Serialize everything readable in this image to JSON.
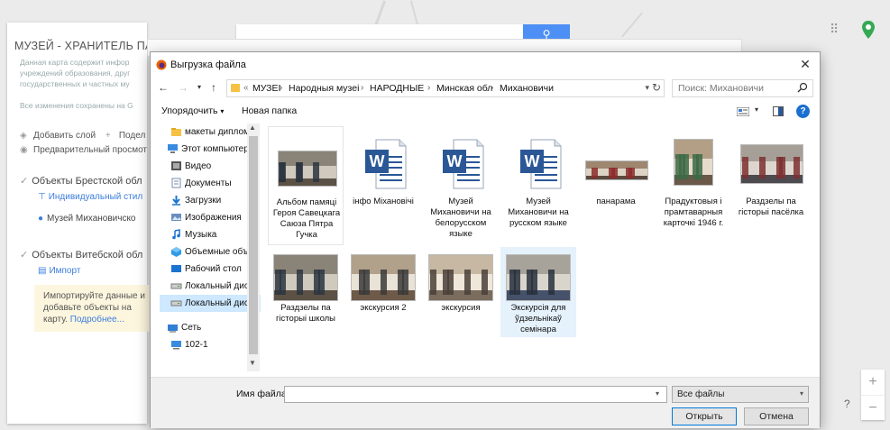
{
  "background": {
    "title": "МУЗЕЙ - ХРАНИТЕЛЬ ПА",
    "desc_lines": [
      "Данная карта содержит инфор",
      "учреждений образования, друг",
      "государственных и частных му"
    ],
    "saved_text": "Все изменения сохранены на G",
    "add_layer": "Добавить слой",
    "share": "Подел",
    "preview": "Предварительный просмот",
    "layer1": "Объекты Брестской обл",
    "layer1_style": "Индивидуальный стил",
    "layer1_item": "Музей Михановичско",
    "layer2": "Объекты Витебской обл",
    "import": "Импорт",
    "hint_text": "Импортируйте данные и добавьте объекты на карту.",
    "hint_more": "Подробнее...",
    "help": "?",
    "zoom_in": "+",
    "zoom_out": "−"
  },
  "dialog": {
    "title": "Выгрузка файла",
    "address": {
      "crumbs": [
        "МУЗЕІ",
        "Народныя музеі",
        "НАРОДНЫЕ",
        "Минская обл",
        "Михановичи"
      ]
    },
    "search_placeholder": "Поиск: Михановичи",
    "toolbar": {
      "organize": "Упорядочить",
      "new_folder": "Новая папка"
    },
    "tree": [
      {
        "label": "макеты дипломо",
        "icon": "folder-icon"
      },
      {
        "label": "Этот компьютер",
        "icon": "computer-icon"
      },
      {
        "label": "Видео",
        "icon": "video-icon"
      },
      {
        "label": "Документы",
        "icon": "documents-icon"
      },
      {
        "label": "Загрузки",
        "icon": "downloads-icon"
      },
      {
        "label": "Изображения",
        "icon": "pictures-icon"
      },
      {
        "label": "Музыка",
        "icon": "music-icon"
      },
      {
        "label": "Объемные объе",
        "icon": "3d-objects-icon"
      },
      {
        "label": "Рабочий стол",
        "icon": "desktop-icon"
      },
      {
        "label": "Локальный диск",
        "icon": "drive-icon"
      },
      {
        "label": "Локальный диск",
        "icon": "drive-icon"
      },
      {
        "label": "Сеть",
        "icon": "network-icon"
      },
      {
        "label": "102-1",
        "icon": "network-computer-icon"
      }
    ],
    "files": [
      {
        "name": "Альбом памяці Героя Савецкага Саюза Пятра Гучка",
        "kind": "photo"
      },
      {
        "name": "інфо Міхановічі",
        "kind": "word"
      },
      {
        "name": "Музей Михановичи на белорусском языке",
        "kind": "word"
      },
      {
        "name": "Музей Михановичи на русском языке",
        "kind": "word"
      },
      {
        "name": "панарама",
        "kind": "panorama"
      },
      {
        "name": "Прадуктовыя і прамтаварныя карточкі 1946 г.",
        "kind": "photo"
      },
      {
        "name": "Раздзелы па гісторыі пасёлка",
        "kind": "photo"
      },
      {
        "name": "Раздзелы па гісторыі школы",
        "kind": "photo"
      },
      {
        "name": "экскурсия 2",
        "kind": "photo"
      },
      {
        "name": "экскурсия",
        "kind": "photo"
      },
      {
        "name": "Экскурсія для ўдзельнікаў семінара",
        "kind": "photo"
      }
    ],
    "file_name_label": "Имя файла:",
    "file_name_value": "",
    "file_type": "Все файлы",
    "open_label": "Открыть",
    "cancel_label": "Отмена"
  },
  "colors": {
    "accent": "#0078d7",
    "selection": "#cde8ff",
    "word_blue": "#2b5797",
    "folder_yellow": "#f6c246"
  }
}
